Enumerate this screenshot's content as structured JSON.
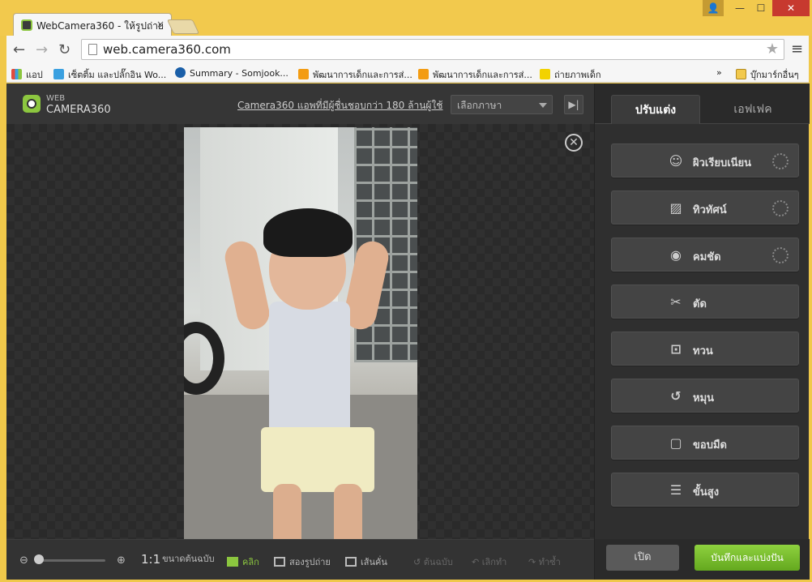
{
  "browser": {
    "tab_title": "WebCamera360 - ให้รูปถ่าย",
    "tab_close": "×",
    "window_buttons": {
      "minimize": "—",
      "maximize": "☐",
      "close": "✕",
      "user": "👤"
    },
    "url": "web.camera360.com",
    "bookmarks": [
      {
        "label": "แอป",
        "color": "#e14c3c"
      },
      {
        "label": "เซ็ตติ้ม และปลั๊กอิน Wo...",
        "color": "#3aa0e0"
      },
      {
        "label": "Summary - Somjook...",
        "color": "#1a5fa8"
      },
      {
        "label": "พัฒนาการเด็กและการส่...",
        "color": "#f39c12"
      },
      {
        "label": "พัฒนาการเด็กและการส่...",
        "color": "#f39c12"
      },
      {
        "label": "ถ่ายภาพเด็ก",
        "color": "#f2d200"
      }
    ],
    "bookmarks_more": "»",
    "other_bookmarks": "บุ๊กมาร์กอื่นๆ"
  },
  "app": {
    "logo_top": "WEB",
    "logo_name": "CAMERA360",
    "header_link": "Camera360 แอพที่มีผู้ชื่นชอบกว่า 180 ล้านผู้ใช้",
    "language_select": "เลือกภาษา",
    "collapse_label": "▶|",
    "close_photo": "✕",
    "bottom": {
      "ratio": "1:1",
      "original_size": "ขนาดต้นฉบับ",
      "click": "คลิก",
      "compare": "สองรูปถ่าย",
      "split": "เส้นคั่น",
      "original": "ต้นฉบับ",
      "undo": "เลิกทำ",
      "redo": "ทำซ้ำ"
    },
    "panel": {
      "tabs": [
        "ปรับแต่ง",
        "เอฟเฟค"
      ],
      "tools": [
        {
          "label": "ผิวเรียบเนียน",
          "icon": "face-icon",
          "glyph": "☺",
          "loading": true
        },
        {
          "label": "ทิวทัศน์",
          "icon": "landscape-icon",
          "glyph": "▨",
          "loading": true
        },
        {
          "label": "คมชัด",
          "icon": "eye-icon",
          "glyph": "◉",
          "loading": true
        },
        {
          "label": "ตัด",
          "icon": "scissors-icon",
          "glyph": "✂",
          "loading": false
        },
        {
          "label": "ทวน",
          "icon": "crop-icon",
          "glyph": "⊡",
          "loading": false
        },
        {
          "label": "หมุน",
          "icon": "rotate-icon",
          "glyph": "↺",
          "loading": false
        },
        {
          "label": "ขอบมืด",
          "icon": "vignette-icon",
          "glyph": "▢",
          "loading": false
        },
        {
          "label": "ขั้นสูง",
          "icon": "sliders-icon",
          "glyph": "☰",
          "loading": false
        }
      ],
      "open_button": "เปิด",
      "save_button": "บันทึกและแบ่งปัน"
    }
  }
}
